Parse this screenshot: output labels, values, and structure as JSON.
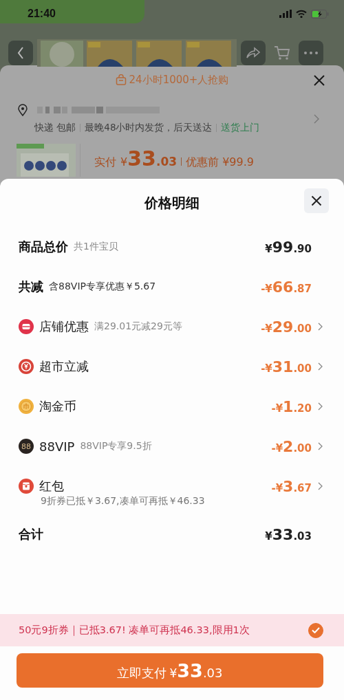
{
  "status_bar": {
    "time": "21:40"
  },
  "background_sheet": {
    "headline": "24小时1000+人抢购",
    "delivery": [
      {
        "text": "快递 包邮",
        "highlight": false
      },
      {
        "text": "最晚48小时内发货，后天送达",
        "highlight": false
      },
      {
        "text": "送货上门",
        "highlight": true
      }
    ],
    "price_label": "实付",
    "price": {
      "currency": "¥",
      "main": "33",
      "fraction": ".03"
    },
    "original_price": "优惠前 ¥99.9"
  },
  "price_detail": {
    "title": "价格明细",
    "rows": [
      {
        "kind": "summary",
        "label": "商品总价",
        "note": "共1件宝贝",
        "price": {
          "currency": "¥",
          "main": "99",
          "fraction": ".90"
        },
        "highlight": false
      },
      {
        "kind": "summary",
        "label": "共减",
        "note": "含88VIP专享优惠￥5.67",
        "price": {
          "sign": "-",
          "currency": "¥",
          "main": "66",
          "fraction": ".87"
        },
        "highlight": true
      },
      {
        "kind": "shop",
        "label": "店铺优惠",
        "note": "满29.01元减29元等",
        "price": {
          "sign": "-",
          "currency": "¥",
          "main": "29",
          "fraction": ".00"
        },
        "highlight": true
      },
      {
        "kind": "instant",
        "label": "超市立减",
        "price": {
          "sign": "-",
          "currency": "¥",
          "main": "31",
          "fraction": ".00"
        },
        "highlight": true
      },
      {
        "kind": "coin",
        "label": "淘金币",
        "price": {
          "sign": "-",
          "currency": "¥",
          "main": "1",
          "fraction": ".20"
        },
        "highlight": true
      },
      {
        "kind": "vip",
        "icon_text": "88",
        "label": "88VIP",
        "note": "88VIP专享9.5折",
        "price": {
          "sign": "-",
          "currency": "¥",
          "main": "2",
          "fraction": ".00"
        },
        "highlight": true
      },
      {
        "kind": "envelope",
        "label": "红包",
        "detail": "9折券已抵￥3.67,凑单可再抵￥46.33",
        "price": {
          "sign": "-",
          "currency": "¥",
          "main": "3",
          "fraction": ".67"
        },
        "highlight": true
      },
      {
        "kind": "total",
        "label": "合计",
        "price": {
          "currency": "¥",
          "main": "33",
          "fraction": ".03"
        },
        "highlight": false
      }
    ]
  },
  "coupon_bar": {
    "text": "50元9折券｜已抵3.67! 凑单可再抵46.33,限用1次",
    "checked": true
  },
  "pay_button": {
    "label": "立即支付",
    "price": {
      "currency": "¥",
      "main": "33",
      "fraction": ".03"
    }
  }
}
